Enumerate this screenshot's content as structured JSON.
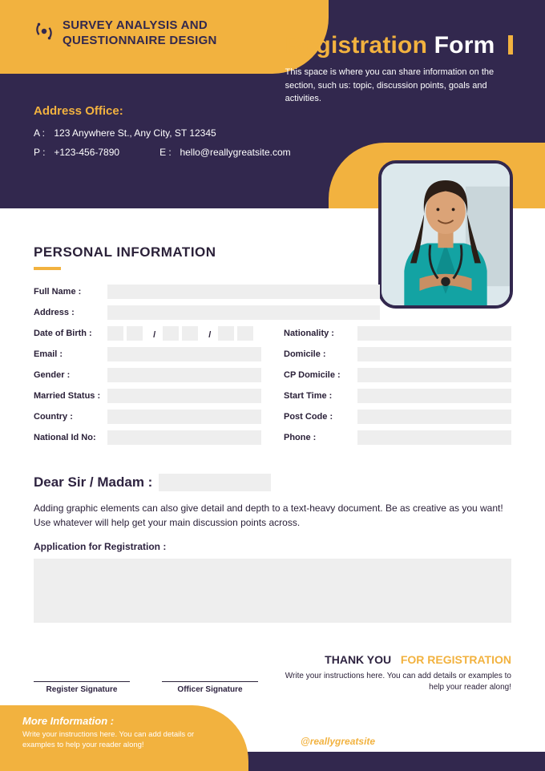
{
  "brand": {
    "title": "SURVEY ANALYSIS AND QUESTIONNAIRE DESIGN"
  },
  "registration": {
    "title_accent": "Registration",
    "title_plain": "Form",
    "description": "This space is where you can share information on the section, such us: topic, discussion points, goals and activities."
  },
  "address": {
    "heading": "Address Office:",
    "a_label": "A :",
    "a_value": "123 Anywhere St., Any City, ST 12345",
    "p_label": "P :",
    "p_value": "+123-456-7890",
    "e_label": "E :",
    "e_value": "hello@reallygreatsite.com"
  },
  "section": {
    "personal": "PERSONAL INFORMATION"
  },
  "fields": {
    "full_name": "Full Name :",
    "address": "Address :",
    "dob": "Date of Birth :",
    "email": "Email :",
    "gender": "Gender :",
    "married": "Married Status :",
    "country": "Country :",
    "national_id": "National Id No:",
    "nationality": "Nationality :",
    "domicile": "Domicile :",
    "cp_domicile": "CP Domicile :",
    "start_time": "Start Time :",
    "post_code": "Post Code :",
    "phone": "Phone :",
    "dob_sep": "/"
  },
  "letter": {
    "greeting": "Dear Sir / Madam :",
    "body": "Adding graphic elements can also give detail and depth to a text-heavy document. Be as creative as you want! Use whatever will help get your main discussion points across.",
    "app_label": "Application for Registration :"
  },
  "signatures": {
    "register": "Register Signature",
    "officer": "Officer Signature"
  },
  "thanks": {
    "line1": "THANK YOU",
    "line2": "FOR REGISTRATION",
    "body": "Write your instructions here. You can add details or examples to help your reader along!"
  },
  "more": {
    "title": "More Information :",
    "body": "Write your instructions here. You can add details or examples to help your reader along!"
  },
  "footer": {
    "handle": "@reallygreatsite"
  }
}
